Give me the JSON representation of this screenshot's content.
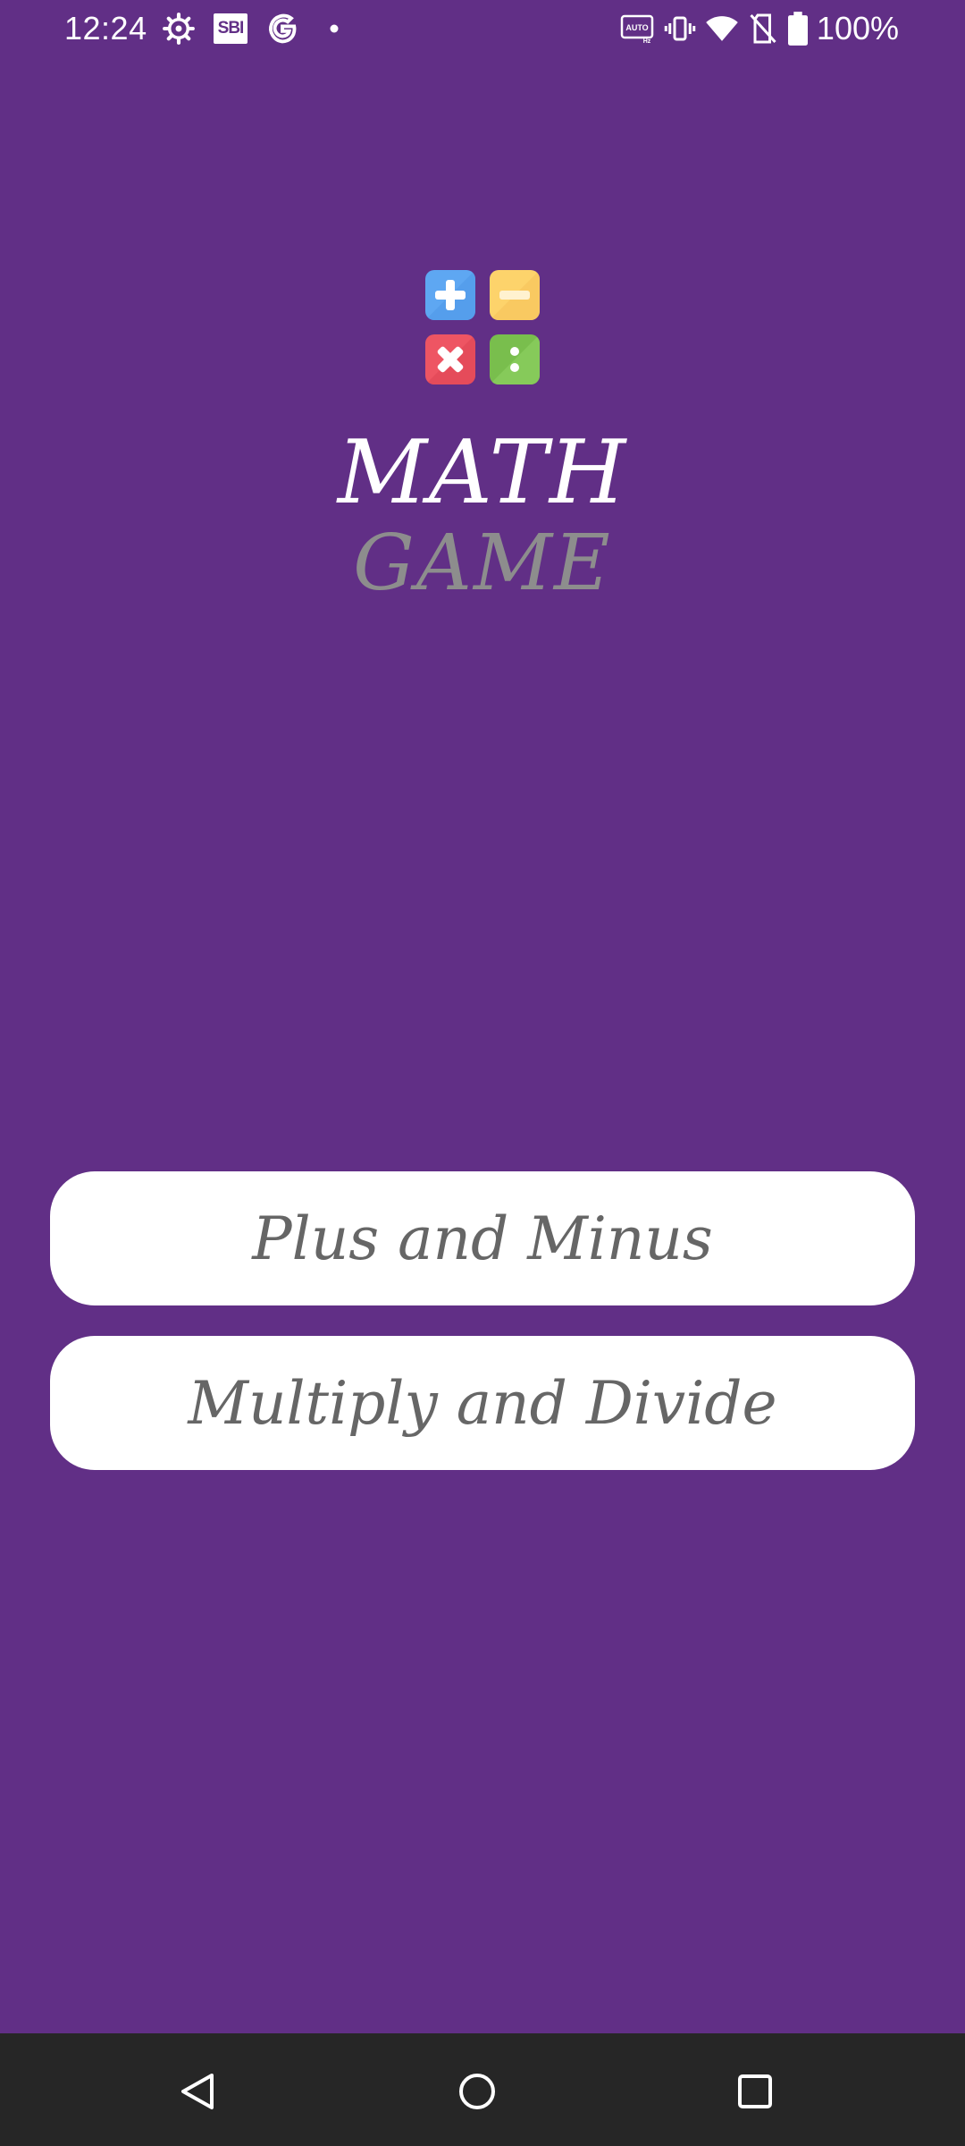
{
  "status_bar": {
    "time": "12:24",
    "sbi_label": "SBI",
    "battery_percent": "100%",
    "icons": [
      "settings-gear-icon",
      "sbi-icon",
      "google-icon",
      "notification-dot-icon",
      "auto-hz-icon",
      "vibrate-icon",
      "wifi-icon",
      "no-sim-icon",
      "battery-icon"
    ]
  },
  "app": {
    "title_line1": "MATH",
    "title_line2": "GAME",
    "logo_tiles": [
      {
        "name": "plus-tile-icon",
        "color": "#5ea7f2"
      },
      {
        "name": "minus-tile-icon",
        "color": "#fdd36b"
      },
      {
        "name": "multiply-tile-icon",
        "color": "#ee5563"
      },
      {
        "name": "divide-tile-icon",
        "color": "#79be4d"
      }
    ]
  },
  "menu": {
    "plus_minus_label": "Plus and Minus",
    "multiply_divide_label": "Multiply and Divide"
  },
  "colors": {
    "background": "#612f86",
    "button_bg": "#ffffff",
    "button_text": "#666666",
    "title_white": "#ffffff",
    "title_gray": "#8d8d8d",
    "nav_bar": "#262626"
  },
  "nav_bar": {
    "icons": [
      "back-icon",
      "home-icon",
      "recents-icon"
    ]
  }
}
